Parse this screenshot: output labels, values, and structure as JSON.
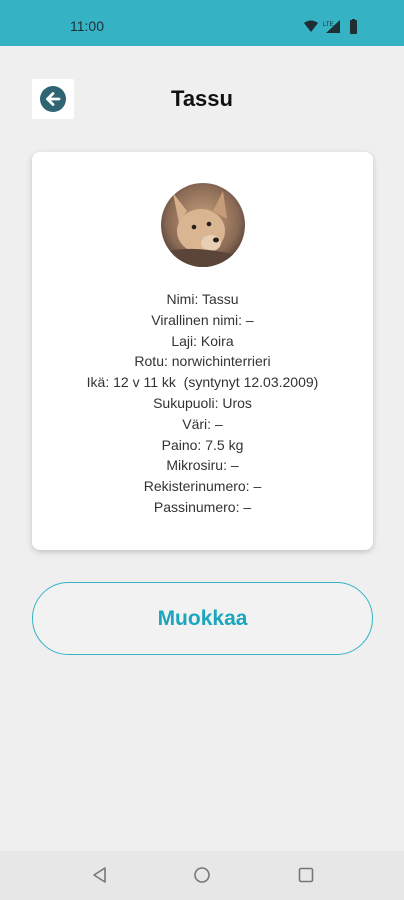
{
  "status_bar": {
    "time": "11:00",
    "icons": [
      "wifi-icon",
      "lte-signal-icon",
      "battery-icon"
    ],
    "color": "#35b3c5"
  },
  "header": {
    "back_icon": "arrow-left-circle-icon",
    "title": "Tassu"
  },
  "profile": {
    "avatar": "dog-photo",
    "details": [
      "Nimi: Tassu",
      "Virallinen nimi: –",
      "Laji: Koira",
      "Rotu: norwichinterrieri",
      "Ikä: 12 v 11 kk  (syntynyt 12.03.2009)",
      "Sukupuoli: Uros",
      "Väri: –",
      "Paino: 7.5 kg",
      "Mikrosiru: –",
      "Rekisterinumero: –",
      "Passinumero: –"
    ]
  },
  "actions": {
    "edit_label": "Muokkaa",
    "accent": "#1aa6bd"
  },
  "navigation": {
    "buttons": [
      "back-triangle-icon",
      "home-circle-icon",
      "recents-square-icon"
    ]
  }
}
